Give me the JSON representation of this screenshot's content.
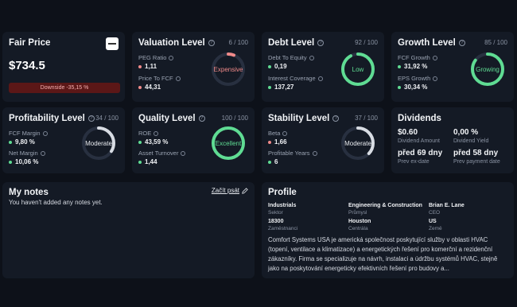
{
  "fair_price": {
    "title": "Fair Price",
    "price": "$734.5",
    "badge": "Downside -35,15 %",
    "logo_icon": "company-logo"
  },
  "valuation": {
    "title": "Valuation Level",
    "score": "6 / 100",
    "gauge_label": "Expensive",
    "gauge_value": 6,
    "gauge_color": "#f08a8a",
    "metrics": [
      {
        "label": "PEG Ratio",
        "value": "1,11",
        "status": "red"
      },
      {
        "label": "Price To FCF",
        "value": "44,31",
        "status": "red"
      }
    ]
  },
  "debt": {
    "title": "Debt Level",
    "score": "92 / 100",
    "gauge_label": "Low",
    "gauge_value": 92,
    "gauge_color": "#5fdc93",
    "metrics": [
      {
        "label": "Debt To Equity",
        "value": "0,19",
        "status": "green"
      },
      {
        "label": "Interest Coverage",
        "value": "137,27",
        "status": "green"
      }
    ]
  },
  "growth": {
    "title": "Growth Level",
    "score": "85 / 100",
    "gauge_label": "Growing",
    "gauge_value": 85,
    "gauge_color": "#5fdc93",
    "metrics": [
      {
        "label": "FCF Growth",
        "value": "31,92 %",
        "status": "green"
      },
      {
        "label": "EPS Growth",
        "value": "30,34 %",
        "status": "green"
      }
    ]
  },
  "profitability": {
    "title": "Profitability Level",
    "score": "34 / 100",
    "gauge_label": "Moderate",
    "gauge_value": 34,
    "gauge_color": "#d8dce3",
    "metrics": [
      {
        "label": "FCF Margin",
        "value": "9,80 %",
        "status": "green"
      },
      {
        "label": "Net Margin",
        "value": "10,06 %",
        "status": "green"
      }
    ]
  },
  "quality": {
    "title": "Quality Level",
    "score": "100 / 100",
    "gauge_label": "Excellent",
    "gauge_value": 100,
    "gauge_color": "#5fdc93",
    "metrics": [
      {
        "label": "ROE",
        "value": "43,59 %",
        "status": "green"
      },
      {
        "label": "Asset Turnover",
        "value": "1,44",
        "status": "green"
      }
    ]
  },
  "stability": {
    "title": "Stability Level",
    "score": "37 / 100",
    "gauge_label": "Moderate",
    "gauge_value": 37,
    "gauge_color": "#d8dce3",
    "metrics": [
      {
        "label": "Beta",
        "value": "1,66",
        "status": "red"
      },
      {
        "label": "Profitable Years",
        "value": "6",
        "status": "green"
      }
    ]
  },
  "dividends": {
    "title": "Dividends",
    "items": [
      {
        "value": "$0.60",
        "label": "Dividend Amount"
      },
      {
        "value": "0,00 %",
        "label": "Dividend Yield"
      },
      {
        "value": "před 69 dny",
        "label": "Prev ex-date"
      },
      {
        "value": "před 58 dny",
        "label": "Prev payment date"
      }
    ]
  },
  "notes": {
    "title": "My notes",
    "empty_text": "You haven't added any notes yet.",
    "write_link": "Začít psát",
    "write_icon": "pencil-icon"
  },
  "profile": {
    "title": "Profile",
    "fields": [
      {
        "value": "Industrials",
        "label": "Sektor"
      },
      {
        "value": "Engineering & Construction",
        "label": "Průmysl"
      },
      {
        "value": "Brian E. Lane",
        "label": "CEO"
      },
      {
        "value": "18300",
        "label": "Zaměstnanci"
      },
      {
        "value": "Houston",
        "label": "Centrála"
      },
      {
        "value": "US",
        "label": "Země"
      }
    ],
    "description": "Comfort Systems USA je americká společnost poskytující služby v oblasti HVAC (topení, ventilace a klimatizace) a energetických řešení pro komerční a rezidenční zákazníky. Firma se specializuje na návrh, instalaci a údržbu systémů HVAC, stejně jako na poskytování energeticky efektivních řešení pro budovy a..."
  }
}
